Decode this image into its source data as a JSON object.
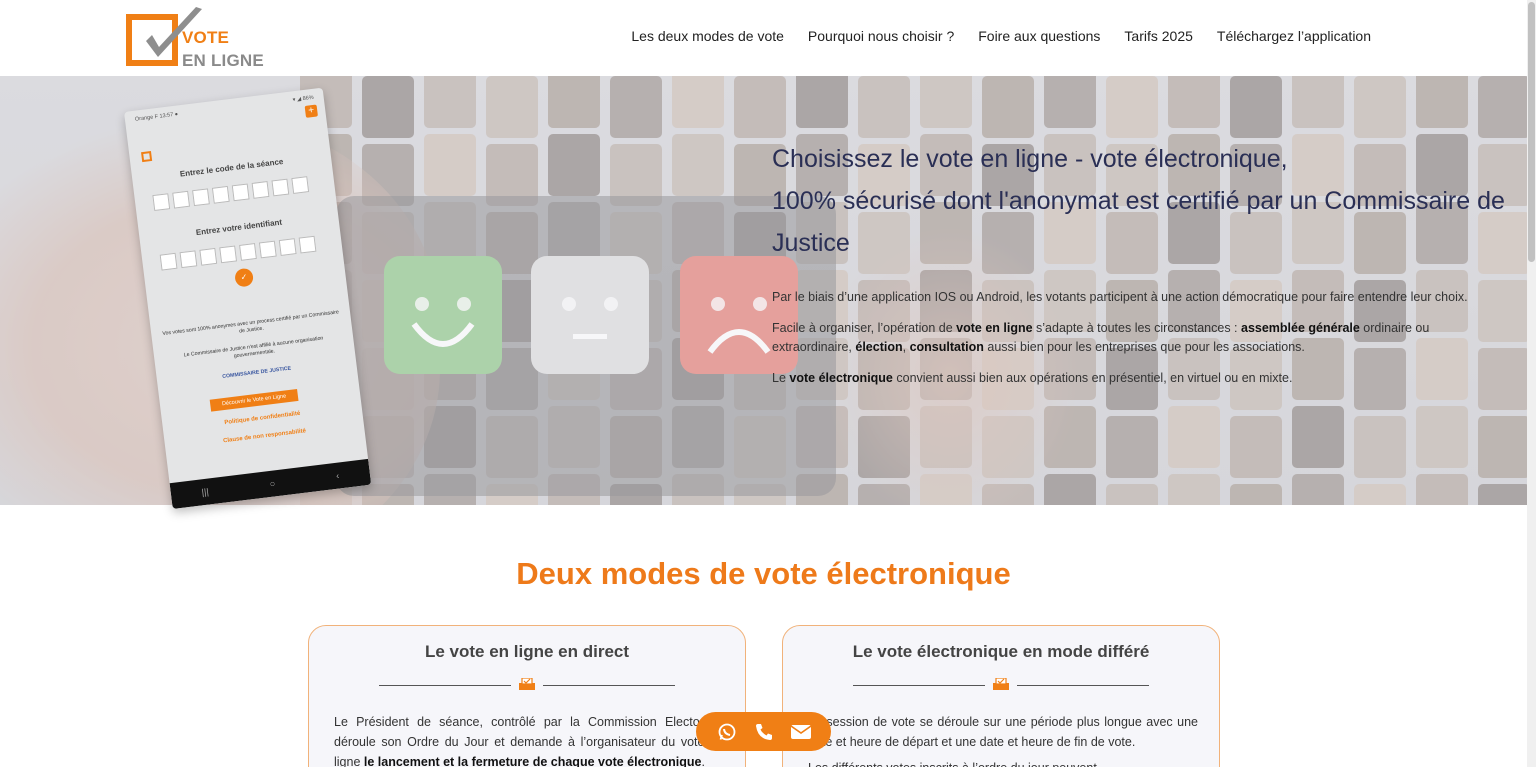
{
  "header": {
    "logo": {
      "line1": "VOTE",
      "line2": "EN LIGNE"
    },
    "nav": [
      "Les deux modes de vote",
      "Pourquoi nous choisir ?",
      "Foire aux questions",
      "Tarifs 2025",
      "Téléchargez l’application"
    ]
  },
  "hero": {
    "title_line1": "Choisissez le vote en ligne - vote électronique,",
    "title_line2": "100% sécurisé dont l'anonymat est certifié par un Commissaire de Justice",
    "p1": "Par le biais d’une application IOS ou Android, les votants participent à une action démocratique pour faire entendre leur choix.",
    "p2": {
      "t1": "Facile à organiser, l’opération de ",
      "b1": "vote en ligne",
      "t2": " s’adapte à toutes les circonstances : ",
      "b2": "assemblée générale",
      "t3": " ordinaire ou extraordinaire, ",
      "b3": "élection",
      "t4": ", ",
      "b4": "consultation",
      "t5": " aussi bien pour les entreprises que pour les associations."
    },
    "p3": {
      "t1": "Le ",
      "b1": "vote électronique",
      "t2": " convient aussi bien aux opérations en présentiel, en virtuel ou en mixte."
    }
  },
  "phone": {
    "carrier": "Orange F  13:57 ●",
    "battery": "▾ ◢ 86%",
    "plus": "+",
    "code_label": "Entrez le code de la séance",
    "id_label": "Entrez votre identifiant",
    "ok": "✓",
    "info1": "Vos votes sont 100% anonymes avec un process certifié par un Commissaire de Justice.",
    "info2": "Le Commissaire de Justice n'est affilié à aucune organisation gouvernementale.",
    "seal": "COMMISSAIRE DE JUSTICE",
    "button": "Découvrir le Vote en Ligne",
    "link1": "Politique de confidentialité",
    "link2": "Clause de non responsabilité",
    "nav": [
      "|||",
      "○",
      "‹"
    ]
  },
  "section": {
    "title": "Deux modes de vote électronique",
    "cards": [
      {
        "title": "Le vote en ligne en direct",
        "body_t1": "Le Président de séance,  contrôlé par la Commission Electorale, déroule son Ordre du Jour et demande à l’organisateur du vote en ligne ",
        "body_b1": "le lancement et la fermeture de chaque vote électronique",
        "body_t2": "."
      },
      {
        "title": "Le vote électronique en mode différé",
        "body_t1": "La session de vote se déroule sur une période plus longue avec une date et heure de départ et une date et heure de fin de vote.",
        "body_t2": "Les différents votes inscrits à l’ordre du jour peuvent"
      }
    ]
  },
  "contact": [
    "whatsapp-icon",
    "phone-icon",
    "mail-icon"
  ],
  "colors": {
    "accent": "#f07f15",
    "title_blue": "#2a2f55",
    "heading_orange": "#ee7a1a"
  }
}
